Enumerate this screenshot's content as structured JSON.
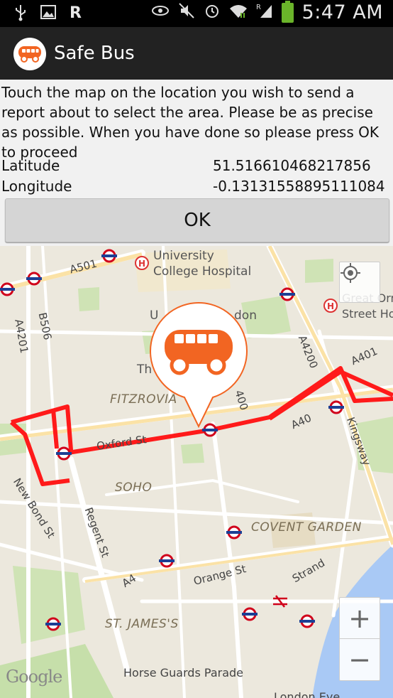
{
  "status_bar": {
    "time": "5:47 AM",
    "left_icons": [
      "usb-icon",
      "image-icon",
      "r-app-icon"
    ],
    "right_icons": [
      "eye-icon",
      "mute-icon",
      "alarm-icon",
      "wifi-icon",
      "signal-icon",
      "battery-icon"
    ]
  },
  "action_bar": {
    "title": "Safe Bus",
    "icon": "bus-icon"
  },
  "form": {
    "instructions": "Touch the map on the location you wish to send a report about to select the area. Please be as precise as possible. When you have done so please press OK to proceed",
    "latitude_label": "Latitude",
    "latitude_value": "51.516610468217856",
    "longitude_label": "Longitude",
    "longitude_value": "-0.13131558895111084",
    "ok_label": "OK"
  },
  "map": {
    "places": {
      "university": "University",
      "college_hospital": "College Hospital",
      "great_ormond": "Great Orm",
      "street_hos": "Street Hos",
      "fitzrovia": "FITZROVIA",
      "soho": "SOHO",
      "covent_garden": "COVENT GARDEN",
      "st_james": "ST. JAMES'S",
      "horse_guards": "Horse Guards Parade",
      "london_eye": "London Eye",
      "u_partial": "U",
      "don_partial": "don",
      "th_partial": "Th"
    },
    "streets": {
      "a501": "A501",
      "b506": "B506",
      "a4201": "A4201",
      "a4200": "A4200",
      "a401": "A401",
      "a40": "A40",
      "n400": "400",
      "kingsway": "Kingsway",
      "oxford_st": "Oxford St",
      "new_bond_st": "New Bond St",
      "regent_st": "Regent St",
      "a4": "A4",
      "orange_st": "Orange St",
      "strand": "Strand"
    },
    "route_color": "#ff1a1a",
    "marker_color": "#f26522",
    "controls": {
      "locate_icon": "my-location-icon",
      "zoom_in": "+",
      "zoom_out": "−"
    },
    "attribution": "Google"
  }
}
